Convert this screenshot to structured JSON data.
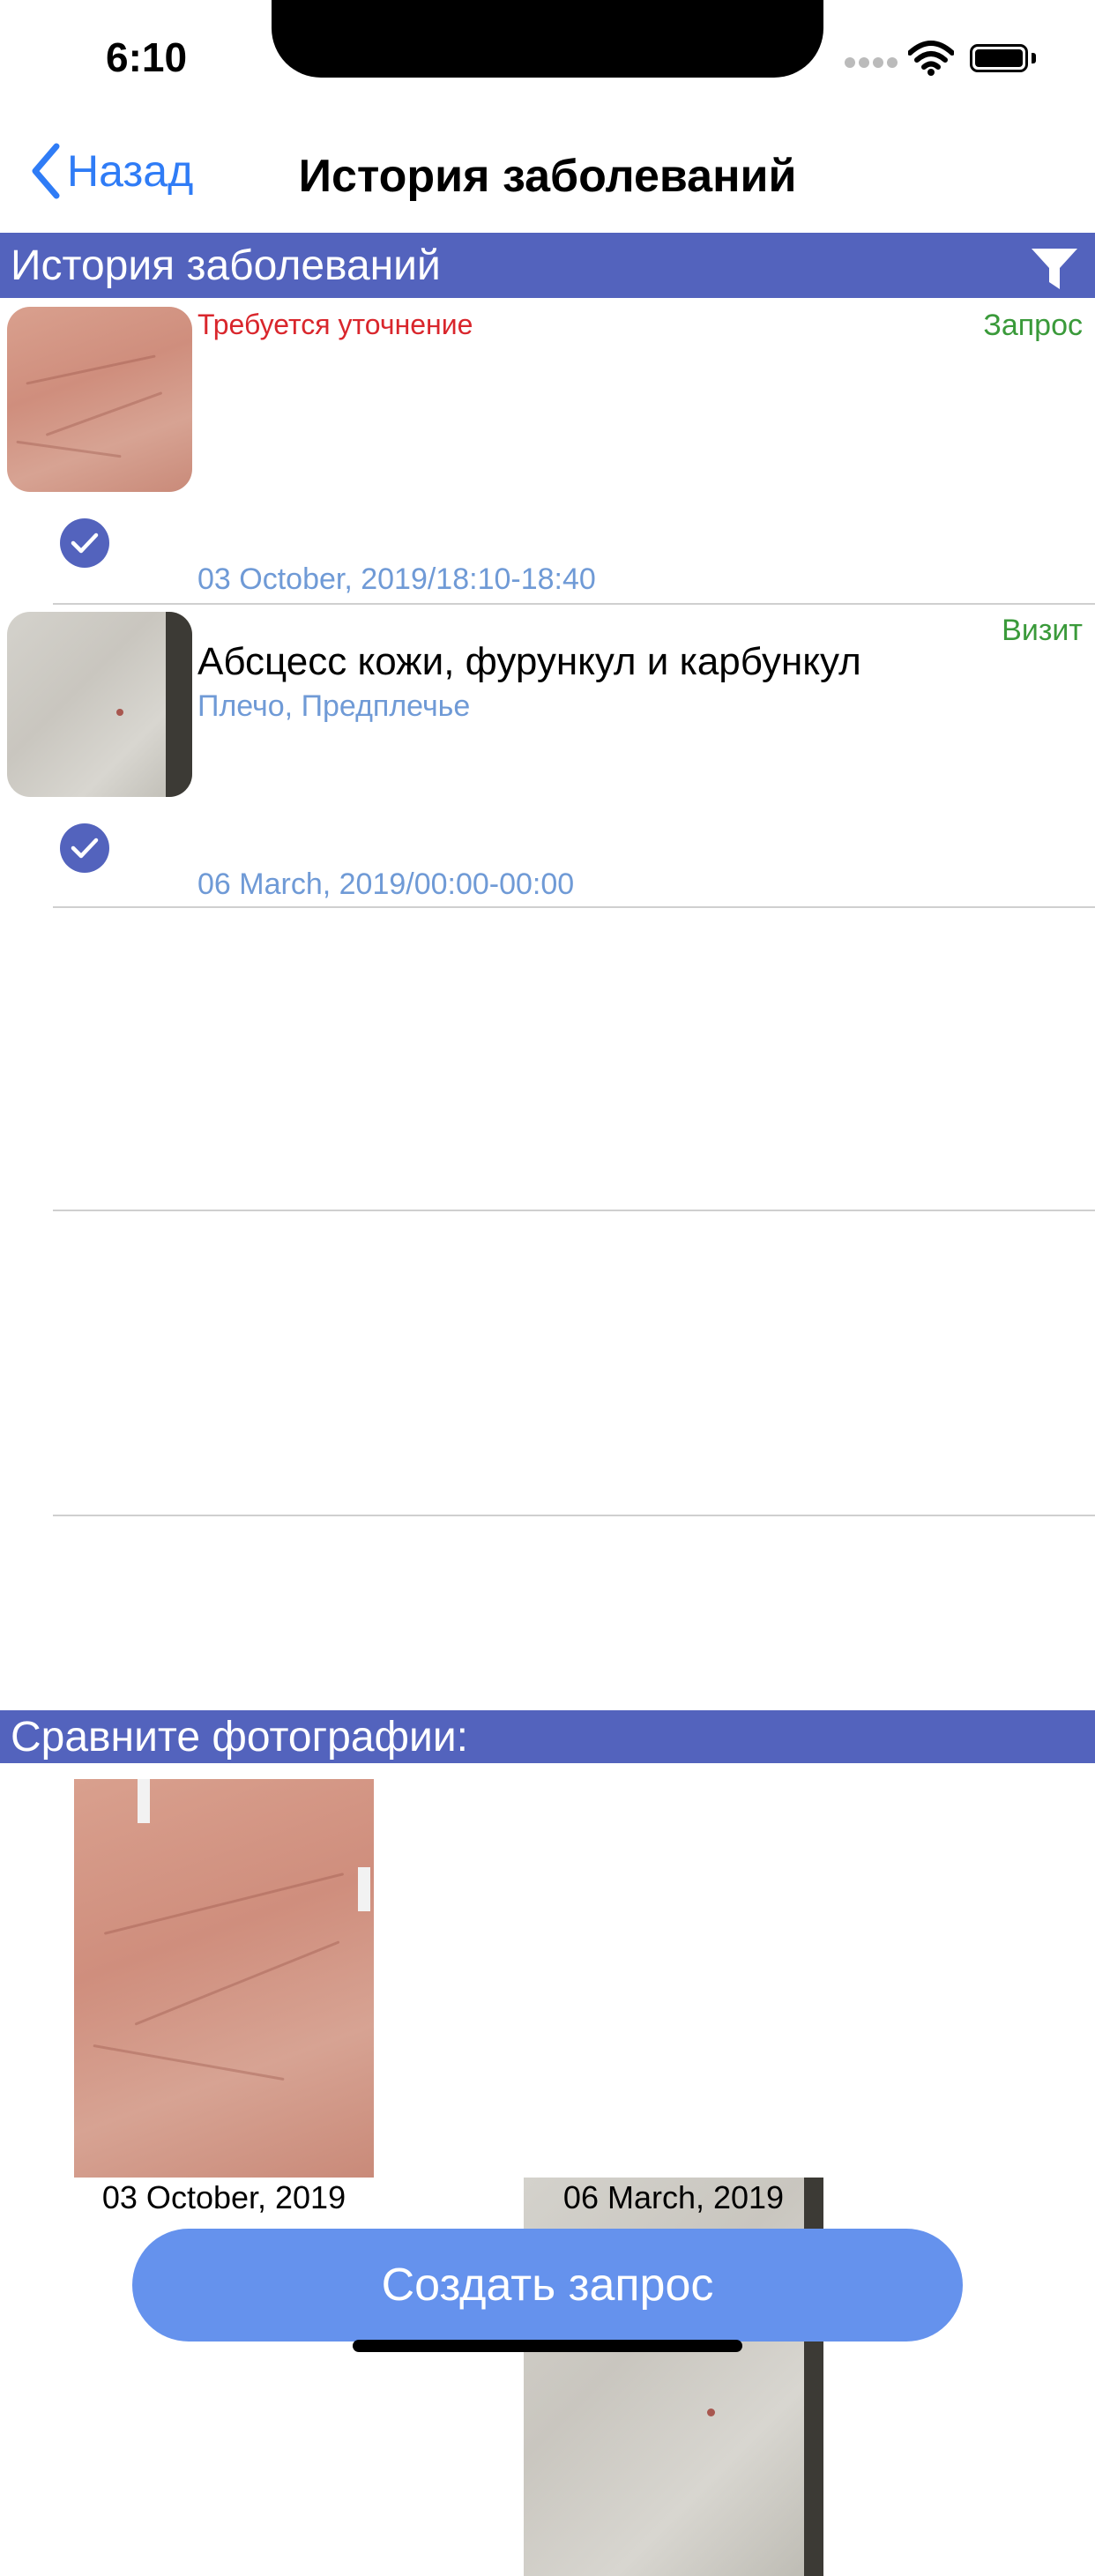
{
  "status_bar": {
    "time": "6:10"
  },
  "nav": {
    "back_label": "Назад",
    "title": "История заболеваний"
  },
  "history_header": {
    "title": "История заболеваний"
  },
  "records": [
    {
      "status": "Требуется уточнение",
      "type": "Запрос",
      "diagnosis": "",
      "location": "",
      "date": "03 October, 2019/18:10-18:40"
    },
    {
      "status": "",
      "type": "Визит",
      "diagnosis": "Абсцесс кожи, фурункул и карбункул",
      "location": "Плечо, Предплечье",
      "date": "06 March, 2019/00:00-00:00"
    }
  ],
  "compare": {
    "title": "Сравните фотографии:",
    "photos": [
      {
        "caption": "03 October, 2019"
      },
      {
        "caption": "06 March, 2019"
      }
    ]
  },
  "actions": {
    "create_request": "Создать запрос"
  },
  "colors": {
    "header_bg": "#5363bd",
    "accent": "#2f7cf6",
    "button": "#6592ed",
    "status_red": "#d9262c",
    "type_green": "#3a9a3a",
    "meta_blue": "#6f9ad6"
  }
}
